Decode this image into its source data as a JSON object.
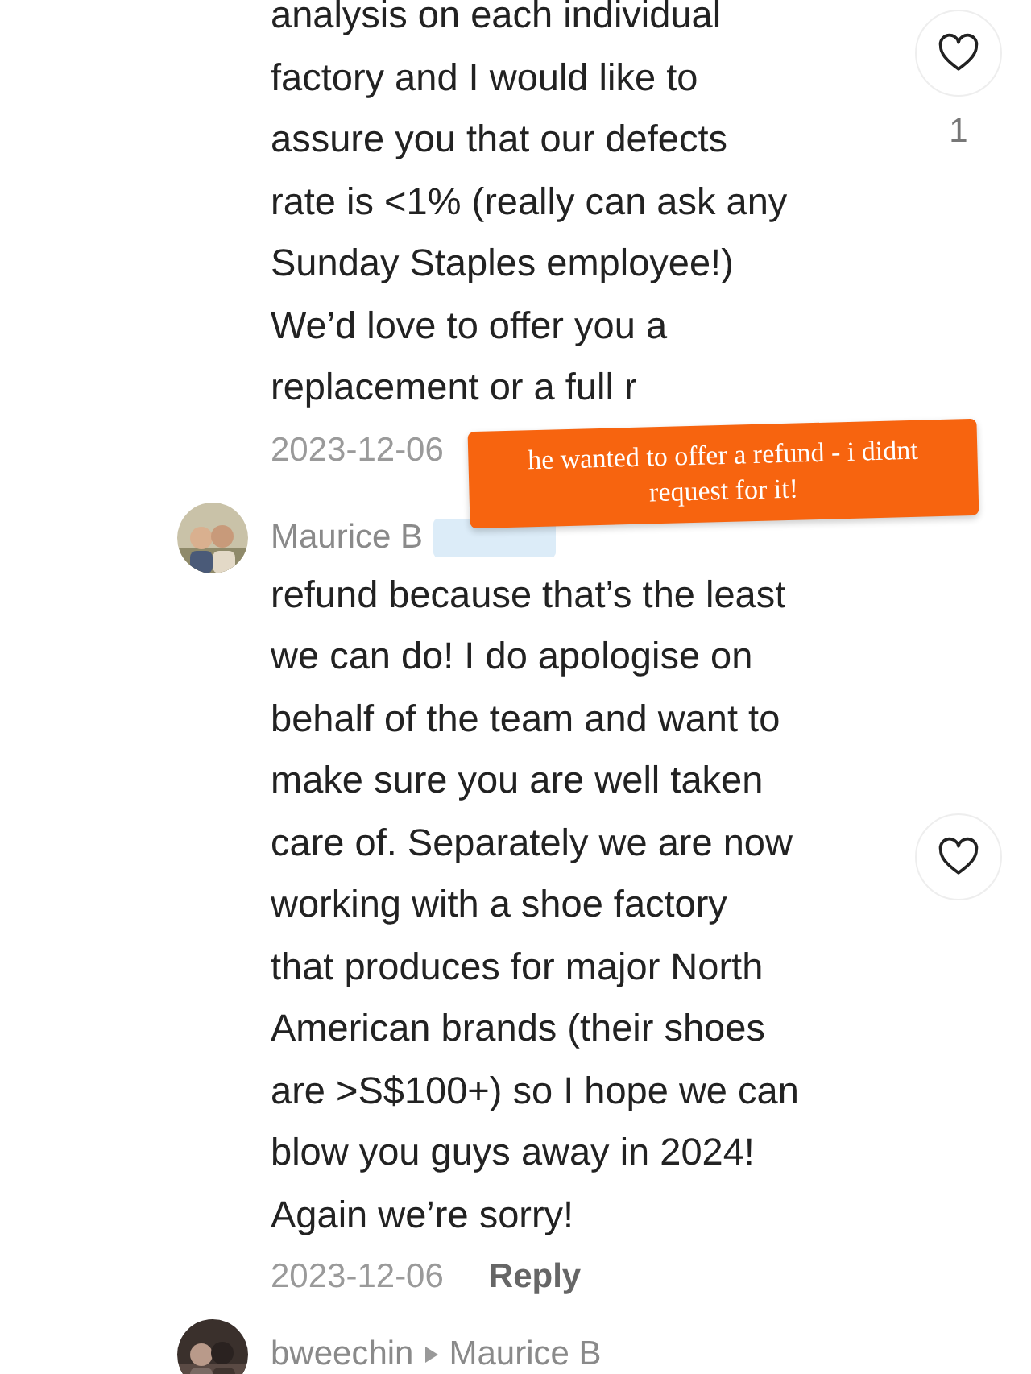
{
  "comments": [
    {
      "lines": [
        "analysis on each individual",
        "factory and I would like to",
        "assure you that our defects",
        "rate is <1% (really can ask any",
        "Sunday Staples employee!)",
        "We’d love to offer you a",
        "replacement or a full r"
      ],
      "date": "2023-12-06",
      "liked": false,
      "like_count": "1"
    },
    {
      "author": "Maurice B",
      "badge": true,
      "lines": [
        "refund because that’s the least",
        "we can do! I do apologise on",
        "behalf of the team and want to",
        "make sure you are well taken",
        "care of. Separately we are now",
        "working with a shoe factory",
        "that produces for major North",
        "American brands (their shoes",
        "are >S$100+) so I hope we can",
        "blow you guys away in 2024!",
        "Again we’re sorry!"
      ],
      "date": "2023-12-06",
      "reply": "Reply",
      "liked": false
    },
    {
      "author": "bweechin",
      "reply_to": "Maurice B"
    }
  ],
  "sticker": {
    "lines": [
      "he wanted to offer a refund - i didnt",
      "request for it!"
    ]
  }
}
